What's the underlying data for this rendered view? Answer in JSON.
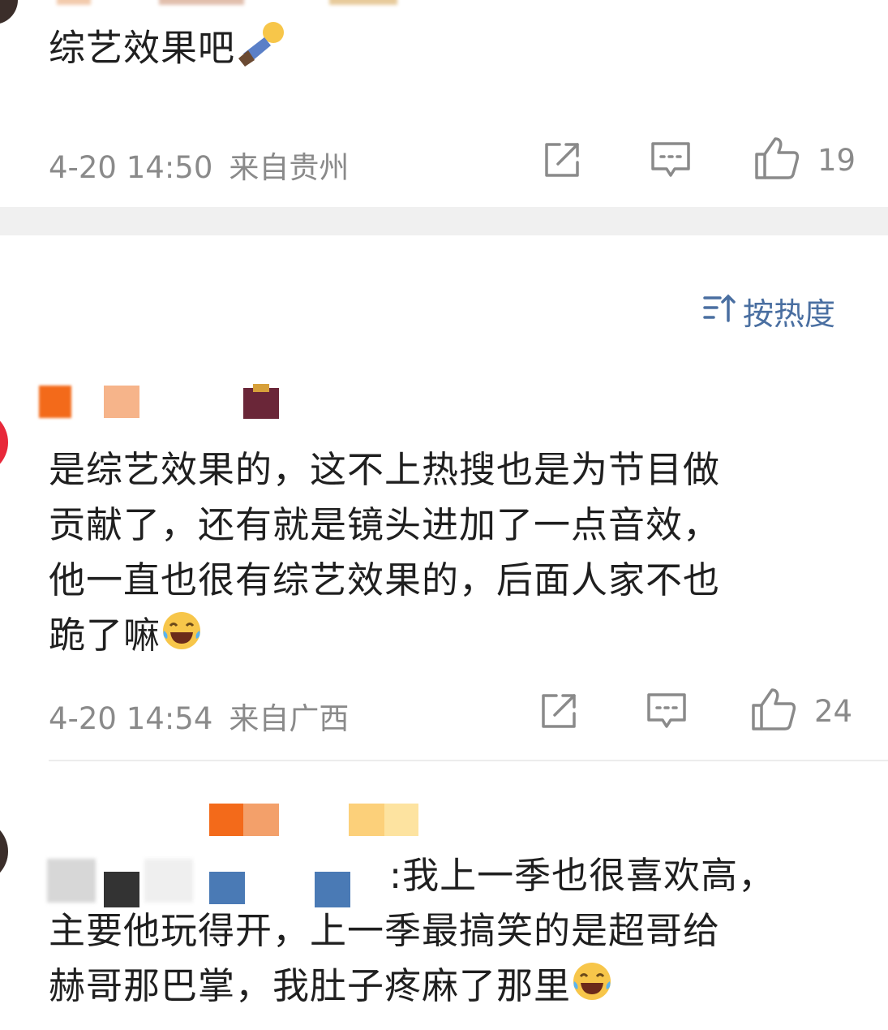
{
  "comments": [
    {
      "text_lines": [
        "综艺效果吧"
      ],
      "time": "4-20 14:50",
      "location": "来自贵州",
      "likes": "19"
    },
    {
      "text_lines": [
        "是综艺效果的，这不上热搜也是为节目做",
        "贡献了，还有就是镜头进加了一点音效，",
        "他一直也很有综艺效果的，后面人家不也",
        "跪了嘛"
      ],
      "time": "4-20 14:54",
      "location": "来自广西",
      "likes": "24"
    },
    {
      "text_lines": [
        ":我上一季也很喜欢高，",
        "主要他玩得开，上一季最搞笑的是超哥给",
        "赫哥那巴掌，我肚子疼麻了那里"
      ]
    }
  ],
  "sort": {
    "label": "按热度",
    "icon": "sort-icon"
  },
  "icons": {
    "share": "share-icon",
    "comment": "comment-icon",
    "like": "thumbs-up-icon"
  },
  "colors": {
    "accent": "#4a6fa1",
    "meta": "#8a8a8a",
    "divider": "#f0f0f0"
  }
}
